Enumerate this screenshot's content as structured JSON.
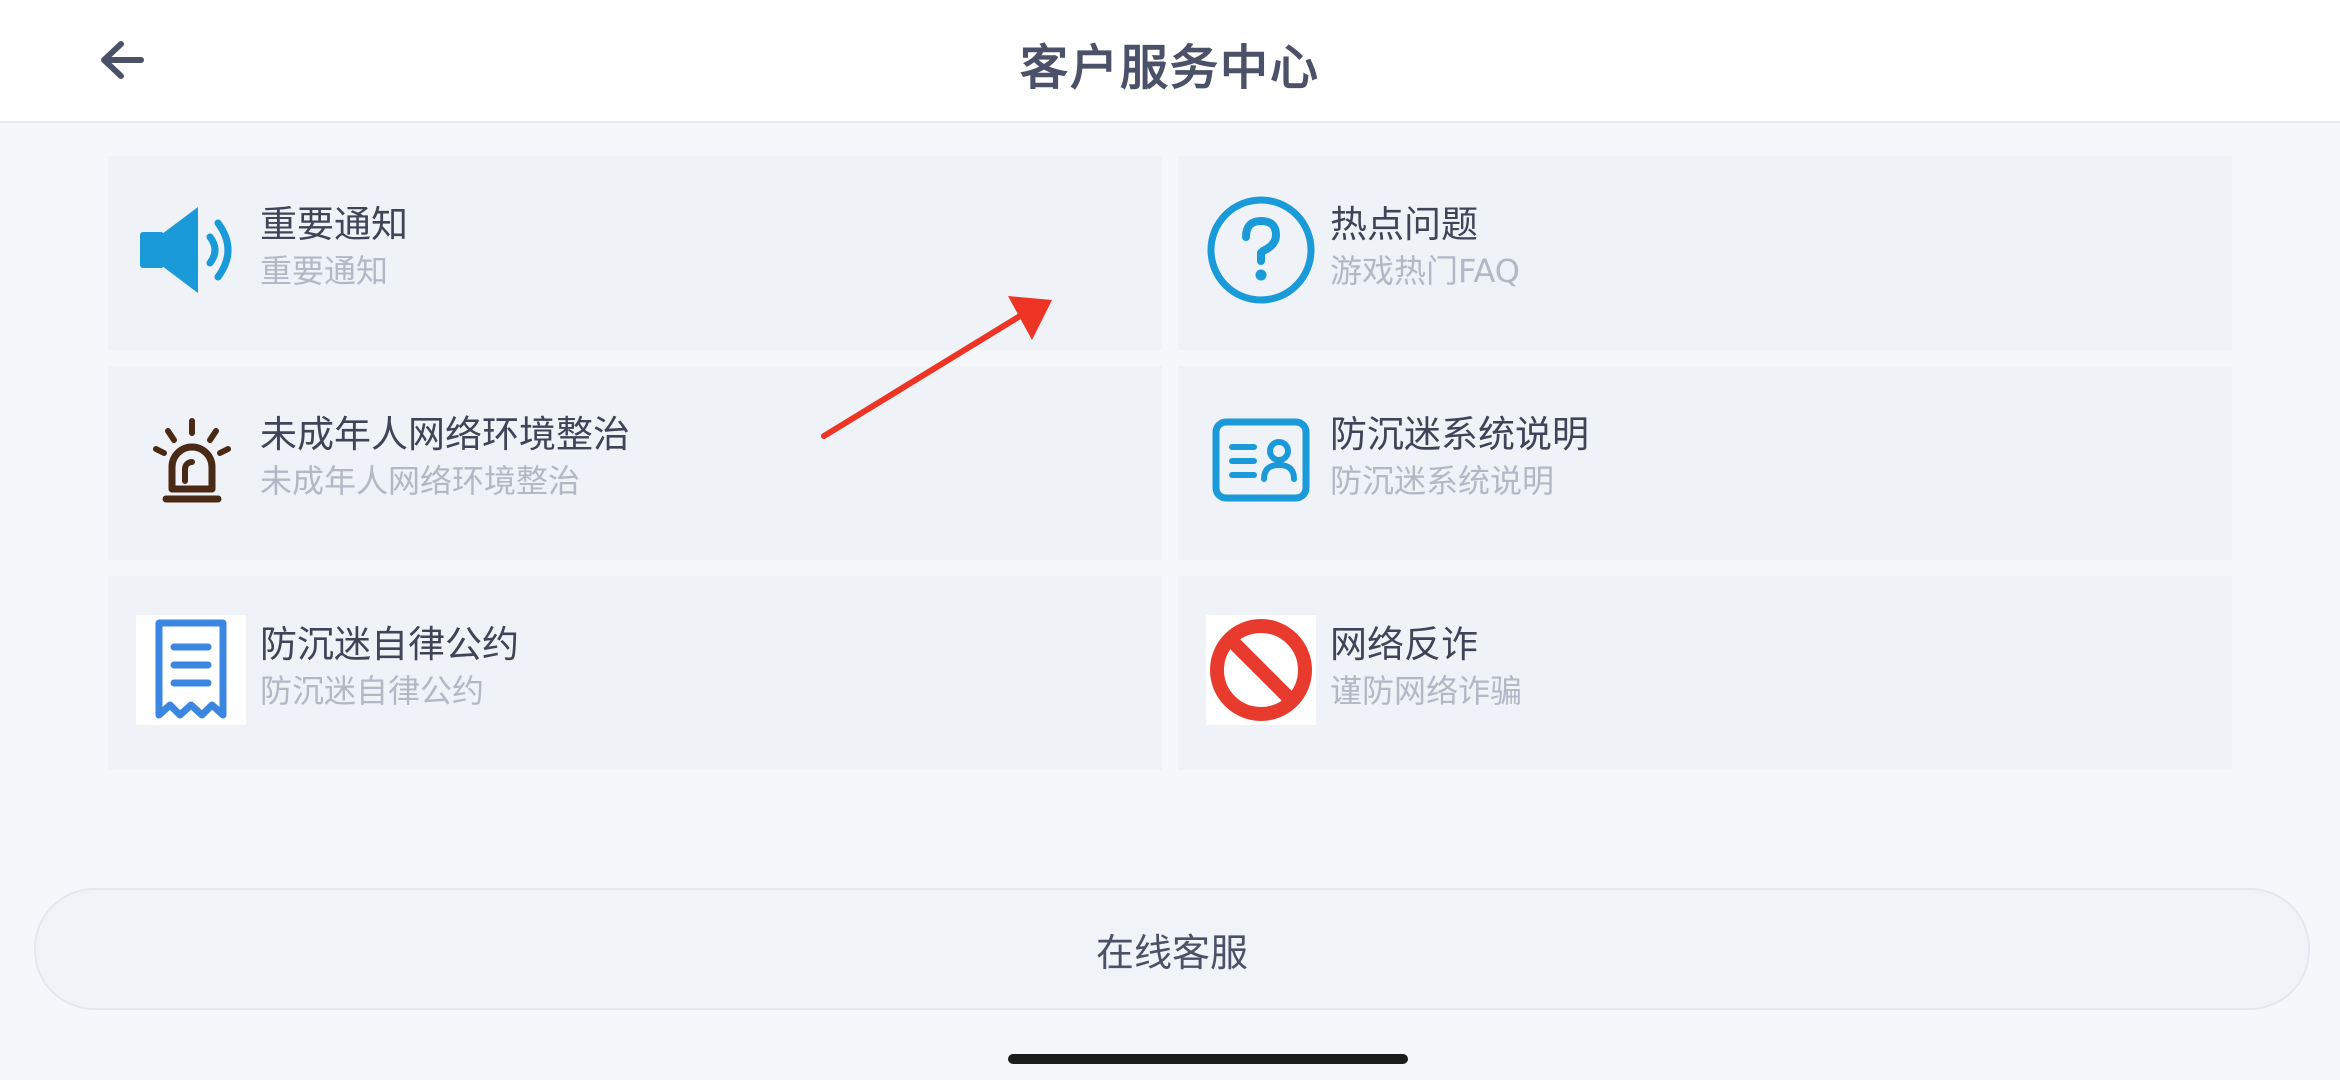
{
  "header": {
    "title": "客户服务中心",
    "back_icon": "arrow-left-icon"
  },
  "cards": [
    {
      "title": "重要通知",
      "subtitle": "重要通知",
      "icon": "speaker-icon",
      "color": "#1a9ad8"
    },
    {
      "title": "热点问题",
      "subtitle": "游戏热门FAQ",
      "icon": "question-circle-icon",
      "color": "#1a9ad8"
    },
    {
      "title": "未成年人网络环境整治",
      "subtitle": "未成年人网络环境整治",
      "icon": "siren-icon",
      "color": "#4a2a14"
    },
    {
      "title": "防沉迷系统说明",
      "subtitle": "防沉迷系统说明",
      "icon": "id-card-icon",
      "color": "#1a9ad8"
    },
    {
      "title": "防沉迷自律公约",
      "subtitle": "防沉迷自律公约",
      "icon": "receipt-icon",
      "color": "#3a86e0"
    },
    {
      "title": "网络反诈",
      "subtitle": "谨防网络诈骗",
      "icon": "prohibited-icon",
      "color": "#e93a2e"
    }
  ],
  "footer": {
    "service_label": "在线客服"
  },
  "colors": {
    "accent": "#1a9ad8",
    "annotation_arrow": "#ee3424",
    "card_bg": "#eff2f6",
    "page_bg": "#f5f7fa"
  }
}
